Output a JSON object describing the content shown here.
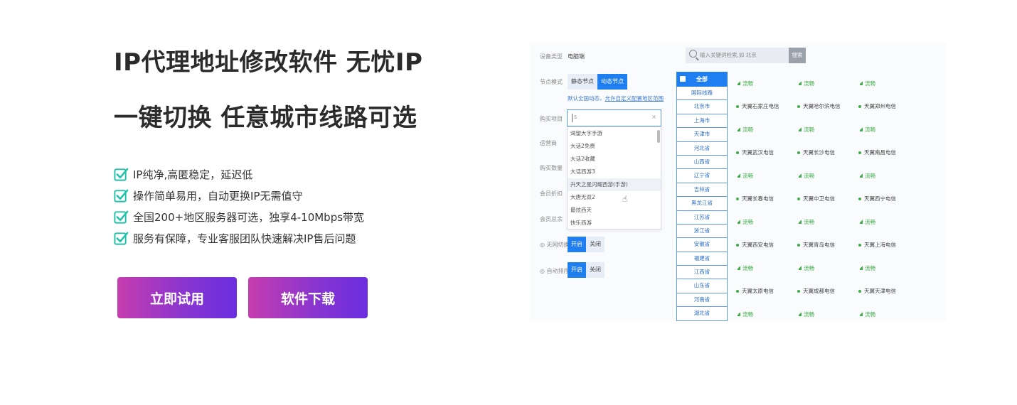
{
  "hero": {
    "title_line1": "IP代理地址修改软件 无忧IP",
    "title_line2": "一键切换 任意城市线路可选",
    "features": [
      "IP纯净,高匿稳定，延迟低",
      "操作简单易用，自动更换IP无需值守",
      "全国200+地区服务器可选，独享4-10Mbps带宽",
      "服务有保障，专业客服团队快速解决IP售后问题"
    ],
    "btn_try": "立即试用",
    "btn_download": "软件下载"
  },
  "colors": {
    "accent_check": "#1fc1a8",
    "btn_start": "#c63cae",
    "btn_end": "#6a2ee0",
    "blue": "#1f7ef0",
    "green": "#3fae49"
  },
  "shot": {
    "device_label": "设备类型",
    "device_value": "电脑端",
    "mode_label": "节点模式",
    "mode_static": "静态节点",
    "mode_dynamic": "动态节点",
    "default_text": "默认全国动态，",
    "custom_link": "允许自定义配置地区范围",
    "game_label": "购买项目",
    "game_input": "s",
    "game_clear": "×",
    "game_options": [
      "渴望大字手游",
      "大话2免费",
      "大话2收藏",
      "大话西游3",
      "升天之星闪耀西游(手游)",
      "大唐无双2",
      "最炫西天",
      "快乐西游"
    ],
    "operator_label": "运营商",
    "qty_label": "购买数量",
    "discount_label": "会员折扣",
    "total_label": "会员总余",
    "nonet_label": "◎ 无网切换",
    "auto_label": "◎ 自动排序",
    "on": "开启",
    "off": "关闭",
    "search_placeholder": "输入关键词检索,如 北京",
    "search_btn": "搜索",
    "all_label": "全部",
    "cities": [
      "国际线路",
      "北京市",
      "上海市",
      "天津市",
      "河北省",
      "山西省",
      "辽宁省",
      "吉林省",
      "黑龙江省",
      "江苏省",
      "浙江省",
      "安徽省",
      "福建省",
      "江西省",
      "山东省",
      "河南省",
      "湖北省"
    ],
    "flow": "流畅",
    "nodes": [
      [
        "天翼石家庄电信",
        "天翼哈尔滨电信",
        "天翼郑州电信"
      ],
      [
        "天翼武汉电信",
        "天翼长沙电信",
        "天翼南昌电信"
      ],
      [
        "天翼长春电信",
        "天翼中卫电信",
        "天翼西宁电信"
      ],
      [
        "天翼西安电信",
        "天翼青岛电信",
        "天翼上海电信"
      ],
      [
        "天翼太原电信",
        "天翼成都电信",
        "天翼天津电信"
      ]
    ]
  }
}
